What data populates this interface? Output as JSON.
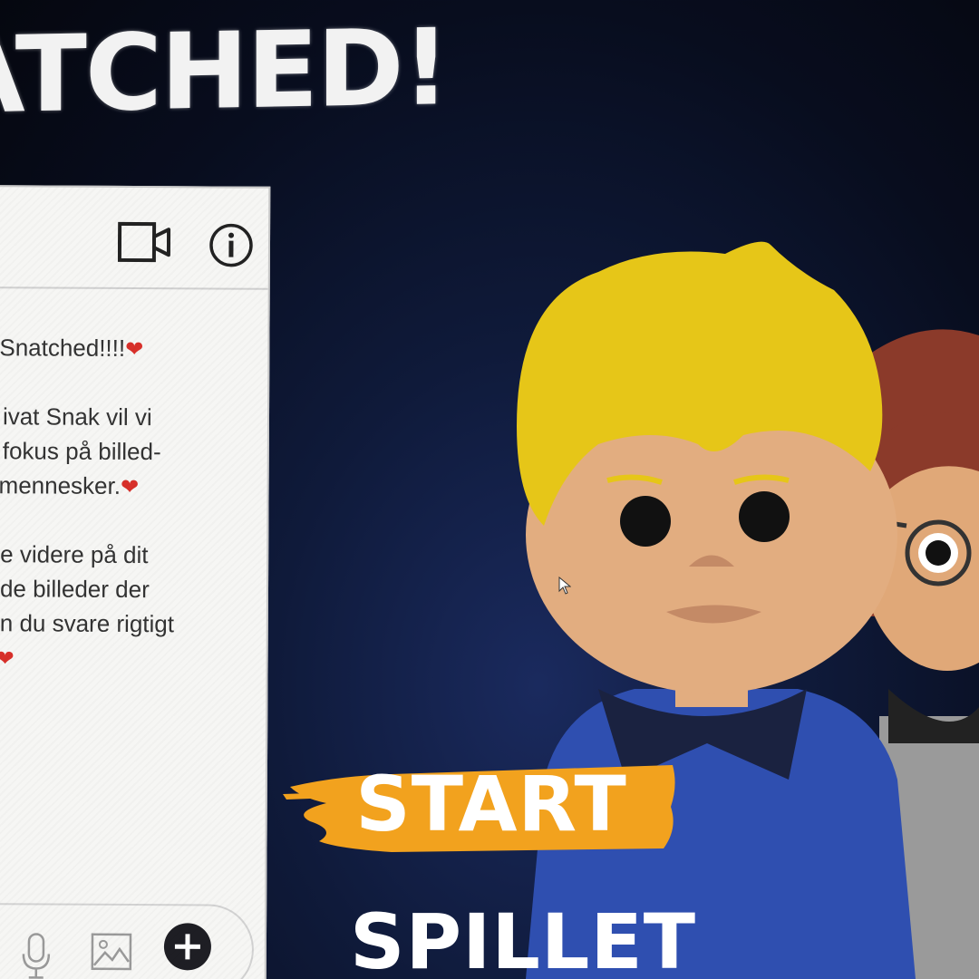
{
  "game": {
    "title": "ATCHED!",
    "start_label": "START",
    "spillet_label": "SPILLET",
    "colors": {
      "background": "#0a1024",
      "brush_orange": "#f2a21e",
      "hair_yellow": "#e6c618",
      "shirt_blue": "#2f4fb0"
    }
  },
  "chat": {
    "header_icons": [
      "video-icon",
      "info-icon"
    ],
    "messages": [
      {
        "text": "Snatched!!!!",
        "heart": "❤"
      },
      {
        "text": "ivat Snak vil vi",
        "heart": ""
      },
      {
        "text": " fokus på billed-",
        "heart": ""
      },
      {
        "text": "mennesker.",
        "heart": "❤"
      },
      {
        "text": "e videre på dit",
        "heart": ""
      },
      {
        "text": "de billeder der",
        "heart": ""
      },
      {
        "text": "n du svare rigtigt",
        "heart": ""
      },
      {
        "text": "",
        "heart": "❤"
      }
    ],
    "footer_icons": [
      "microphone-icon",
      "image-icon",
      "plus-icon"
    ]
  }
}
